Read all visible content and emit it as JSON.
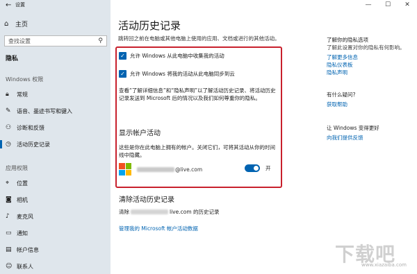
{
  "window": {
    "title": "设置",
    "back_icon": "back-arrow-icon",
    "controls": [
      "—",
      "☐",
      "✕"
    ]
  },
  "sidebar": {
    "home_label": "主页",
    "search_placeholder": "查找设置",
    "category": "隐私",
    "windows_section": "Windows 权限",
    "windows_items": [
      {
        "label": "常规",
        "icon": "lock-icon"
      },
      {
        "label": "语音、墨迹书写和键入",
        "icon": "speech-icon"
      },
      {
        "label": "诊断和反馈",
        "icon": "diagnostics-icon"
      },
      {
        "label": "活动历史记录",
        "icon": "history-icon"
      }
    ],
    "app_section": "应用权限",
    "app_items": [
      {
        "label": "位置",
        "icon": "location-icon"
      },
      {
        "label": "相机",
        "icon": "camera-icon"
      },
      {
        "label": "麦克风",
        "icon": "microphone-icon"
      },
      {
        "label": "通知",
        "icon": "notification-icon"
      },
      {
        "label": "帐户信息",
        "icon": "account-info-icon"
      },
      {
        "label": "联系人",
        "icon": "contacts-icon"
      }
    ]
  },
  "main": {
    "title": "活动历史记录",
    "intro": "跳转回之前在电脑或其他电脑上使用的应用、文档或进行的其他活动。",
    "checkbox1": "允许 Windows 从此电脑中收集我的活动",
    "checkbox2": "允许 Windows 将我的活动从此电脑同步到云",
    "description": "查看“了解详细信息”和“隐私声明”以了解活动历史记录、将活动历史记录发送到 Microsoft 后的情况以及我们如何尊重你的隐私。",
    "show_accounts_heading": "显示帐户活动",
    "show_accounts_desc": "这些是你在此电脑上拥有的帐户。关闭它们，可将其活动从你的时间线中隐藏。",
    "account_email_suffix": "@live.com",
    "toggle_state": "开",
    "clear_heading": "清除活动历史记录",
    "clear_prefix": "清除",
    "clear_suffix": "live.com 的历史记录",
    "manage_link": "管理我的 Microsoft 帐户活动数据"
  },
  "right": {
    "privacy_heading": "了解你的隐私选项",
    "privacy_text": "了解此设置对你的隐私有何影响。",
    "privacy_links": [
      "了解更多信息",
      "隐私仪表板",
      "隐私声明"
    ],
    "question_heading": "有什么疑问?",
    "help_link": "获取帮助",
    "improve_heading": "让 Windows 变得更好",
    "feedback_link": "向我们提供反馈"
  },
  "watermark": {
    "main": "下载吧",
    "sub": "www.xiazaiba.com"
  },
  "colors": {
    "accent": "#0063b1",
    "highlight_border": "#c8202c",
    "sidebar_bg": "#dfe6ec",
    "ms_red": "#f25022",
    "ms_green": "#7fba00",
    "ms_blue": "#00a4ef",
    "ms_yellow": "#ffb900"
  }
}
